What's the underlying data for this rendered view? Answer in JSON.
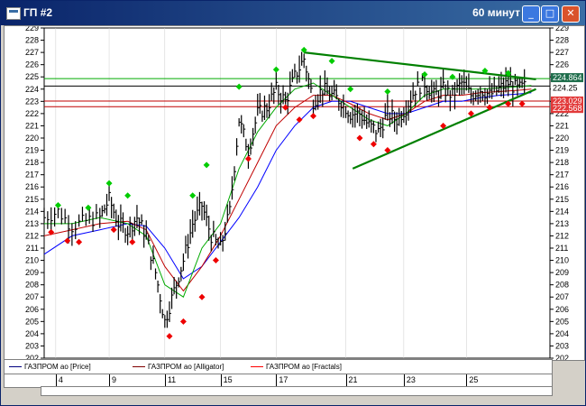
{
  "window": {
    "title": "ГП #2",
    "timeframe": "60 минут",
    "buttons": {
      "minimize": "_",
      "maximize": "□",
      "close": "✕"
    }
  },
  "legend": [
    {
      "label": "ГАЗПРОМ ао [Price]",
      "color": "#000080"
    },
    {
      "label": "ГАЗПРОМ ао [Alligator]",
      "color": "#800000"
    },
    {
      "label": "ГАЗПРОМ ао [Fractals]",
      "color": "#ff0000"
    }
  ],
  "time_axis": {
    "labels": [
      "4",
      "9",
      "11",
      "15",
      "17",
      "21",
      "23",
      "25"
    ]
  },
  "price_labels": {
    "green": "224.864",
    "black": "224.25",
    "red_1": "223.029",
    "red_2": "222.568"
  },
  "colors": {
    "price": "#000000",
    "jaw": "#0000ff",
    "teeth": "#c00000",
    "lips": "#00aa00",
    "fractal_up": "#00cc00",
    "fractal_down": "#ee0000",
    "trendline": "#008000"
  },
  "chart_data": {
    "type": "line",
    "title": "",
    "ylim": [
      202,
      229
    ],
    "yticks": [
      202,
      203,
      204,
      205,
      206,
      207,
      208,
      209,
      210,
      211,
      212,
      213,
      214,
      215,
      216,
      217,
      218,
      219,
      220,
      221,
      222,
      223,
      224,
      225,
      226,
      227,
      228,
      229
    ],
    "x_range": [
      0,
      218
    ],
    "x_ticks": [
      {
        "x": 5,
        "label": "4"
      },
      {
        "x": 28,
        "label": "9"
      },
      {
        "x": 52,
        "label": "11"
      },
      {
        "x": 76,
        "label": "15"
      },
      {
        "x": 100,
        "label": "17"
      },
      {
        "x": 130,
        "label": "21"
      },
      {
        "x": 155,
        "label": "23"
      },
      {
        "x": 182,
        "label": "25"
      }
    ],
    "hlines": [
      {
        "value": 224.864,
        "color": "#00aa00"
      },
      {
        "value": 224.25,
        "color": "#000000"
      },
      {
        "value": 223.029,
        "color": "#c00000"
      },
      {
        "value": 222.568,
        "color": "#c00000"
      }
    ],
    "trendlines": [
      {
        "from": [
          112,
          227.0
        ],
        "to": [
          212,
          224.8
        ]
      },
      {
        "from": [
          133,
          217.5
        ],
        "to": [
          212,
          224.0
        ]
      }
    ],
    "price_path": [
      [
        0,
        213.5
      ],
      [
        6,
        214.0
      ],
      [
        12,
        212.8
      ],
      [
        18,
        213.2
      ],
      [
        24,
        213.5
      ],
      [
        28,
        215.0
      ],
      [
        32,
        213.0
      ],
      [
        36,
        212.5
      ],
      [
        40,
        213.5
      ],
      [
        44,
        212.0
      ],
      [
        48,
        209.0
      ],
      [
        52,
        205.0
      ],
      [
        56,
        207.5
      ],
      [
        60,
        210.0
      ],
      [
        64,
        213.0
      ],
      [
        68,
        214.5
      ],
      [
        72,
        212.0
      ],
      [
        76,
        211.0
      ],
      [
        80,
        214.0
      ],
      [
        84,
        221.5
      ],
      [
        88,
        219.0
      ],
      [
        92,
        222.0
      ],
      [
        96,
        222.5
      ],
      [
        100,
        224.0
      ],
      [
        104,
        223.0
      ],
      [
        108,
        225.0
      ],
      [
        112,
        226.5
      ],
      [
        116,
        223.0
      ],
      [
        120,
        224.0
      ],
      [
        124,
        223.5
      ],
      [
        128,
        223.0
      ],
      [
        132,
        222.0
      ],
      [
        136,
        222.0
      ],
      [
        140,
        221.0
      ],
      [
        144,
        220.5
      ],
      [
        148,
        222.0
      ],
      [
        152,
        221.5
      ],
      [
        156,
        222.5
      ],
      [
        160,
        224.0
      ],
      [
        164,
        224.5
      ],
      [
        168,
        223.5
      ],
      [
        172,
        224.0
      ],
      [
        176,
        223.5
      ],
      [
        180,
        224.5
      ],
      [
        184,
        223.5
      ],
      [
        188,
        224.0
      ],
      [
        192,
        223.5
      ],
      [
        196,
        224.0
      ],
      [
        200,
        224.5
      ],
      [
        204,
        224.0
      ],
      [
        208,
        224.25
      ]
    ],
    "series": [
      {
        "name": "ГАЗПРОМ ао [Alligator]",
        "role": "jaw",
        "values": [
          [
            0,
            210.5
          ],
          [
            12,
            212.0
          ],
          [
            24,
            212.5
          ],
          [
            36,
            213.0
          ],
          [
            44,
            212.8
          ],
          [
            52,
            211.0
          ],
          [
            60,
            208.5
          ],
          [
            68,
            209.5
          ],
          [
            76,
            211.5
          ],
          [
            84,
            213.5
          ],
          [
            92,
            216.0
          ],
          [
            100,
            219.0
          ],
          [
            108,
            221.0
          ],
          [
            116,
            222.5
          ],
          [
            124,
            223.0
          ],
          [
            132,
            223.0
          ],
          [
            140,
            222.5
          ],
          [
            148,
            222.0
          ],
          [
            156,
            222.0
          ],
          [
            164,
            222.5
          ],
          [
            172,
            223.0
          ],
          [
            180,
            223.0
          ],
          [
            188,
            223.3
          ],
          [
            196,
            223.5
          ],
          [
            204,
            223.6
          ],
          [
            210,
            223.7
          ]
        ]
      },
      {
        "name": "ГАЗПРОМ ао [Alligator]",
        "role": "teeth",
        "values": [
          [
            0,
            212.0
          ],
          [
            12,
            212.5
          ],
          [
            24,
            213.0
          ],
          [
            36,
            213.2
          ],
          [
            44,
            212.5
          ],
          [
            52,
            209.5
          ],
          [
            60,
            207.5
          ],
          [
            68,
            209.5
          ],
          [
            76,
            212.0
          ],
          [
            84,
            215.0
          ],
          [
            92,
            218.0
          ],
          [
            100,
            221.0
          ],
          [
            108,
            222.5
          ],
          [
            116,
            223.5
          ],
          [
            124,
            223.5
          ],
          [
            132,
            222.8
          ],
          [
            140,
            222.0
          ],
          [
            148,
            221.5
          ],
          [
            156,
            222.0
          ],
          [
            164,
            223.0
          ],
          [
            172,
            223.5
          ],
          [
            180,
            223.5
          ],
          [
            188,
            223.7
          ],
          [
            196,
            223.8
          ],
          [
            204,
            223.9
          ],
          [
            210,
            224.0
          ]
        ]
      },
      {
        "name": "ГАЗПРОМ ао [Alligator]",
        "role": "lips",
        "values": [
          [
            0,
            213.0
          ],
          [
            12,
            213.0
          ],
          [
            24,
            213.5
          ],
          [
            36,
            213.0
          ],
          [
            44,
            212.0
          ],
          [
            52,
            208.0
          ],
          [
            60,
            207.0
          ],
          [
            68,
            211.0
          ],
          [
            76,
            213.0
          ],
          [
            84,
            217.5
          ],
          [
            92,
            220.5
          ],
          [
            100,
            222.5
          ],
          [
            108,
            224.0
          ],
          [
            116,
            224.5
          ],
          [
            124,
            223.5
          ],
          [
            132,
            222.5
          ],
          [
            140,
            221.5
          ],
          [
            148,
            221.0
          ],
          [
            156,
            222.0
          ],
          [
            164,
            223.5
          ],
          [
            172,
            224.0
          ],
          [
            180,
            224.0
          ],
          [
            188,
            224.0
          ],
          [
            196,
            224.1
          ],
          [
            204,
            224.2
          ],
          [
            210,
            224.3
          ]
        ]
      }
    ],
    "fractals_up": [
      [
        6,
        214.5
      ],
      [
        19,
        214.3
      ],
      [
        28,
        216.3
      ],
      [
        36,
        215.3
      ],
      [
        64,
        215.3
      ],
      [
        70,
        217.8
      ],
      [
        84,
        224.2
      ],
      [
        100,
        225.6
      ],
      [
        112,
        227.2
      ],
      [
        124,
        226.3
      ],
      [
        132,
        224.0
      ],
      [
        148,
        223.8
      ],
      [
        164,
        225.2
      ],
      [
        176,
        225.0
      ],
      [
        190,
        225.5
      ],
      [
        200,
        225.3
      ]
    ],
    "fractals_down": [
      [
        3,
        212.3
      ],
      [
        10,
        211.6
      ],
      [
        15,
        211.5
      ],
      [
        30,
        212.5
      ],
      [
        38,
        211.5
      ],
      [
        54,
        203.8
      ],
      [
        60,
        205.0
      ],
      [
        68,
        207.0
      ],
      [
        74,
        210.0
      ],
      [
        88,
        218.3
      ],
      [
        104,
        222.5
      ],
      [
        110,
        221.5
      ],
      [
        116,
        221.8
      ],
      [
        136,
        220.0
      ],
      [
        142,
        219.5
      ],
      [
        148,
        219.0
      ],
      [
        172,
        221.0
      ],
      [
        184,
        222.0
      ],
      [
        192,
        222.5
      ],
      [
        200,
        222.8
      ],
      [
        206,
        222.8
      ]
    ]
  }
}
